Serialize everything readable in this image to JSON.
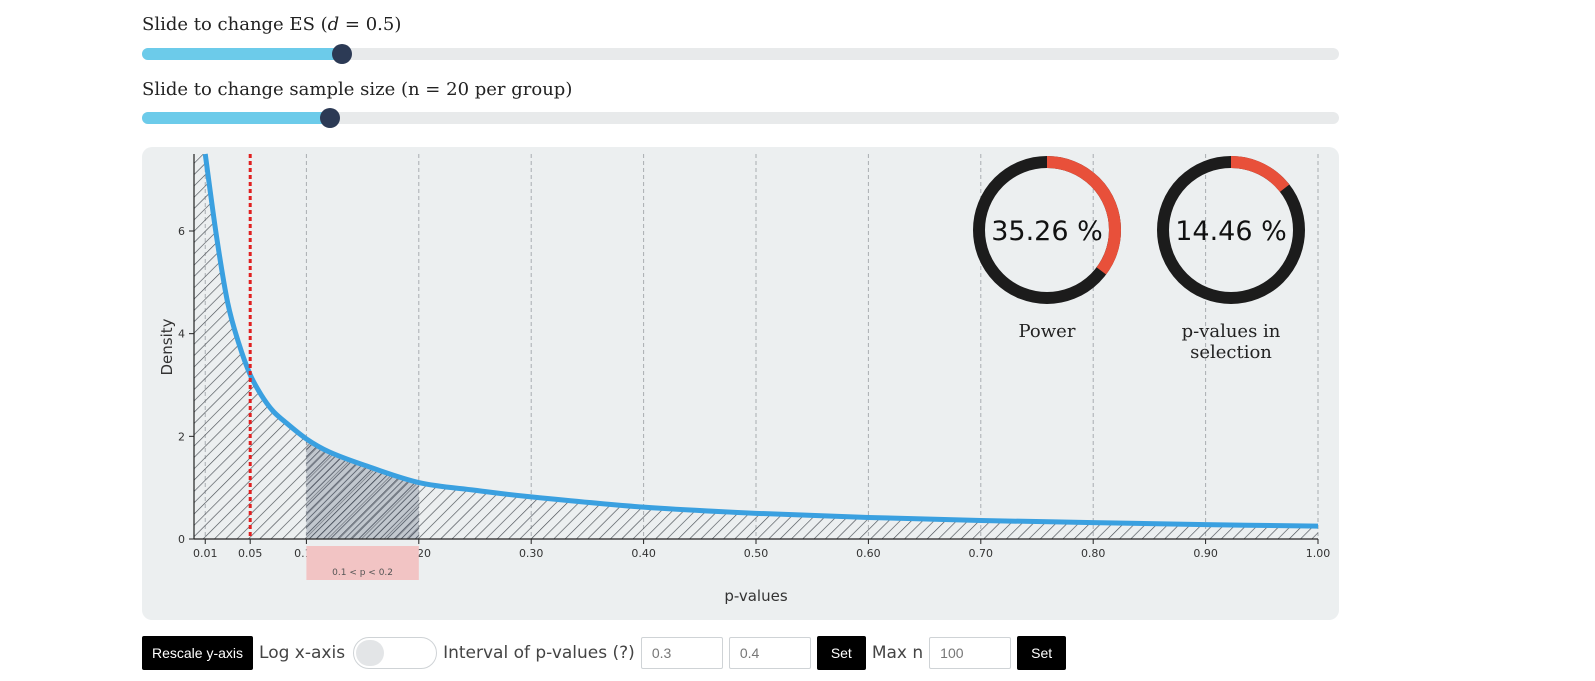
{
  "es_slider": {
    "label_prefix": "Slide to change ES (",
    "label_symbol": "d",
    "label_suffix": " = 0.5)",
    "fraction": 0.167
  },
  "n_slider": {
    "label": "Slide to change sample size (n = 20 per group)",
    "fraction": 0.157
  },
  "colors": {
    "curve": "#3aa0e0",
    "alpha_line": "#e02020",
    "selection_band": "#f2c4c4",
    "donut_bg": "#1c1c1c",
    "donut_fg": "#e8503a",
    "slider_fill": "#6ccbea",
    "slider_thumb": "#2c3a55"
  },
  "chart_data": {
    "type": "area",
    "xlabel": "p-values",
    "ylabel": "Density",
    "xlim": [
      0,
      1
    ],
    "ylim": [
      0,
      7.5
    ],
    "x_ticks": [
      0.01,
      0.05,
      0.1,
      0.2,
      0.3,
      0.4,
      0.5,
      0.6,
      0.7,
      0.8,
      0.9,
      1.0
    ],
    "x_tick_labels": [
      "0.01",
      "0.05",
      "0.10",
      "0.20",
      "0.30",
      "0.40",
      "0.50",
      "0.60",
      "0.70",
      "0.80",
      "0.90",
      "1.00"
    ],
    "y_ticks": [
      0,
      2,
      4,
      6
    ],
    "y_tick_labels": [
      "0",
      "2",
      "4",
      "6"
    ],
    "vertical_gridlines_at": [
      0.01,
      0.1,
      0.2,
      0.3,
      0.4,
      0.5,
      0.6,
      0.7,
      0.8,
      0.9,
      1.0
    ],
    "alpha_line_at": 0.05,
    "curve": {
      "x": [
        0.01,
        0.02,
        0.03,
        0.04,
        0.05,
        0.06,
        0.07,
        0.08,
        0.1,
        0.12,
        0.15,
        0.2,
        0.25,
        0.3,
        0.4,
        0.5,
        0.6,
        0.7,
        0.8,
        0.9,
        1.0
      ],
      "y": [
        7.5,
        5.9,
        4.6,
        3.8,
        3.2,
        2.8,
        2.5,
        2.3,
        1.95,
        1.7,
        1.45,
        1.1,
        0.95,
        0.82,
        0.62,
        0.5,
        0.42,
        0.36,
        0.32,
        0.28,
        0.25
      ]
    },
    "selection": {
      "from": 0.1,
      "to": 0.2,
      "label": "0.1 < p < 0.2"
    },
    "donuts": [
      {
        "value": 35.26,
        "text": "35.26 %",
        "label": "Power"
      },
      {
        "value": 14.46,
        "text": "14.46 %",
        "label": "p-values in selection"
      }
    ]
  },
  "controls": {
    "rescale_label": "Rescale y-axis",
    "log_label": "Log x-axis",
    "interval_label": "Interval of p-values (?)",
    "interval_low_placeholder": "0.3",
    "interval_high_placeholder": "0.4",
    "set_label": "Set",
    "maxn_label": "Max n",
    "maxn_placeholder": "100",
    "set2_label": "Set"
  }
}
